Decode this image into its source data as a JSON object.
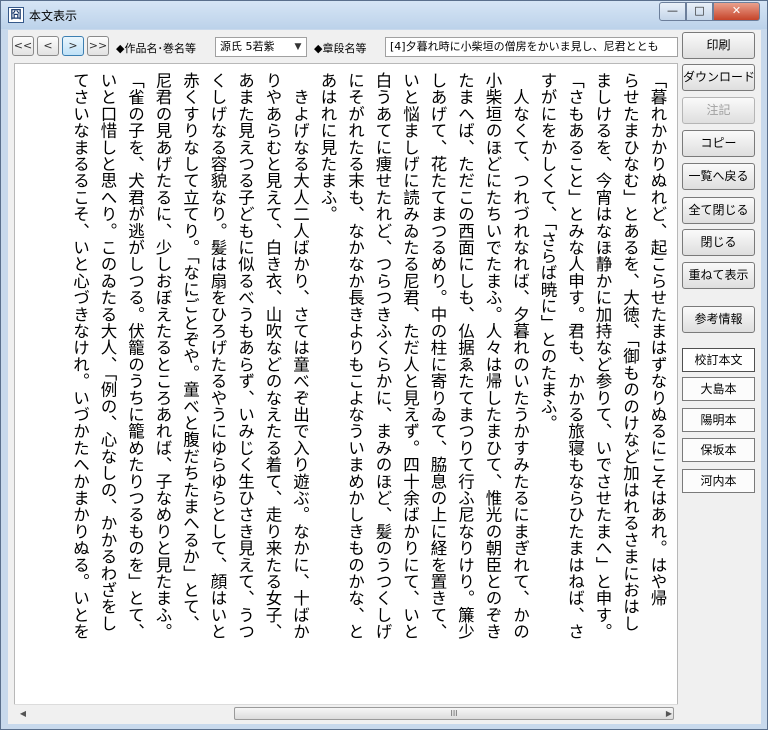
{
  "window": {
    "title": "本文表示",
    "min_glyph": "—",
    "max_glyph": "□",
    "close_glyph": "✕"
  },
  "nav": {
    "first": "<<",
    "prev": "<",
    "next": ">",
    "last": ">>"
  },
  "toolbar": {
    "work_label": "◆作品名･巻名等",
    "work_value": "源氏 5若紫",
    "section_label": "◆章段名等",
    "section_value": "[4]夕暮れ時に小柴垣の僧房をかいま見し、尼君ととも"
  },
  "main_text": "「暮れかかりぬれど、起こらせたまはずなりぬるにこそはあれ。はや帰\nらせたまひなむ」とあるを、大徳、「御もののけなど加はれるさまにおはし\nましけるを、今宵はなほ静かに加持など参りて、いでさせたまへ」と申す。\n「さもあること」とみな人申す。君も、かかる旅寝もならひたまはねば、さ\nすがにをかしくて、「さらば暁に」とのたまふ。\n　人なくて、つれづれなれば、夕暮れのいたうかすみたるにまぎれて、かの\n小柴垣のほどにたちいでたまふ。人々は帰したまひて、惟光の朝臣とのぞき\nたまへば、ただこの西面にしも、仏据ゑたてまつりて行ふ尼なりけり。簾少\nしあげて、花たてまつるめり。中の柱に寄りゐて、脇息の上に経を置きて、\nいと悩ましげに読みゐたる尼君、ただ人と見えず。四十余ばかりにて、いと\n白うあてに痩せたれど、つらつきふくらかに、まみのほど、髪のうつくしげ\nにそがれたる末も、なかなか長きよりもこよなういまめかしきものかな、と\nあはれに見たまふ。\n　きよげなる大人二人ばかり、さては童べぞ出で入り遊ぶ。なかに、十ばか\nりやあらむと見えて、白き衣、山吹などのなえたる着て、走り来たる女子、\nあまた見えつる子どもに似るべうもあらず、いみじく生ひさき見えて、うつ\nくしげなる容貌なり。髪は扇をひろげたるやうにゆらゆらとして、顔はいと\n赤くすりなして立てり。「なにごとぞや。童べと腹だちたまへるか」とて、\n尼君の見あげたるに、少しおぼえたるところあれば、子なめりと見たまふ。\n「雀の子を、犬君が逃がしつる。伏籠のうちに籠めたりつるものを」とて、\nいと口惜しと思へり。このゐたる大人、「例の、心なしの、かかるわざをし\nてさいなまるるこそ、いと心づきなけれ。いづかたへかまかりぬる。いとを",
  "buttons": {
    "print": "印刷",
    "download": "ダウンロード",
    "notes": "注記",
    "copy": "コピー",
    "back_to_list": "一覧へ戻る",
    "close_all": "全て閉じる",
    "close": "閉じる",
    "tile_display": "重ねて表示",
    "reference": "参考情報"
  },
  "versions": [
    "校訂本文",
    "大島本",
    "陽明本",
    "保坂本",
    "河内本"
  ],
  "scroll": {
    "left_arrow": "◀",
    "right_arrow": "▶",
    "grip": "III"
  }
}
